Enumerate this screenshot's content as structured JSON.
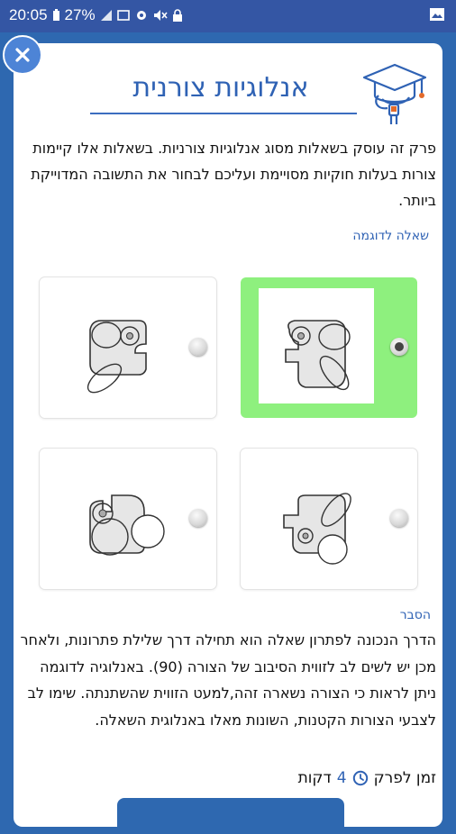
{
  "status_bar": {
    "time": "20:05",
    "battery": "27%"
  },
  "header": {
    "title": "אנלוגיות צורנית",
    "close_icon": "close-icon",
    "logo_icon": "graduation-cap-brush-icon"
  },
  "intro": {
    "text": "פרק זה עוסק בשאלות מסוג אנלוגיות צורניות. בשאלות אלו קיימות צורות בעלות חוקיות מסויימת ועליכם לבחור את התשובה המדוייקת ביותר."
  },
  "example_link": "שאלה לדוגמה",
  "options": [
    {
      "id": "option-top-right",
      "selected": true
    },
    {
      "id": "option-top-left",
      "selected": false
    },
    {
      "id": "option-bottom-right",
      "selected": false
    },
    {
      "id": "option-bottom-left",
      "selected": false
    }
  ],
  "explanation": {
    "label": "הסבר",
    "text": "הדרך הנכונה לפתרון שאלה הוא תחילה דרך שלילת פתרונות, ולאחר מכן יש לשים לב לזווית הסיבוב של הצורה (90). באנלוגיה לדוגמה ניתן לראות כי הצורה נשארה זהה,למעט הזווית שהשתנתה. שימו לב לצבעי הצורות הקטנות, השונות מאלו באנלוגית השאלה."
  },
  "time": {
    "label": "זמן לפרק",
    "value": "4",
    "unit": "דקות"
  },
  "colors": {
    "accent": "#2f62b4",
    "selected": "#8ef07e",
    "statusbar": "#3456a4"
  }
}
